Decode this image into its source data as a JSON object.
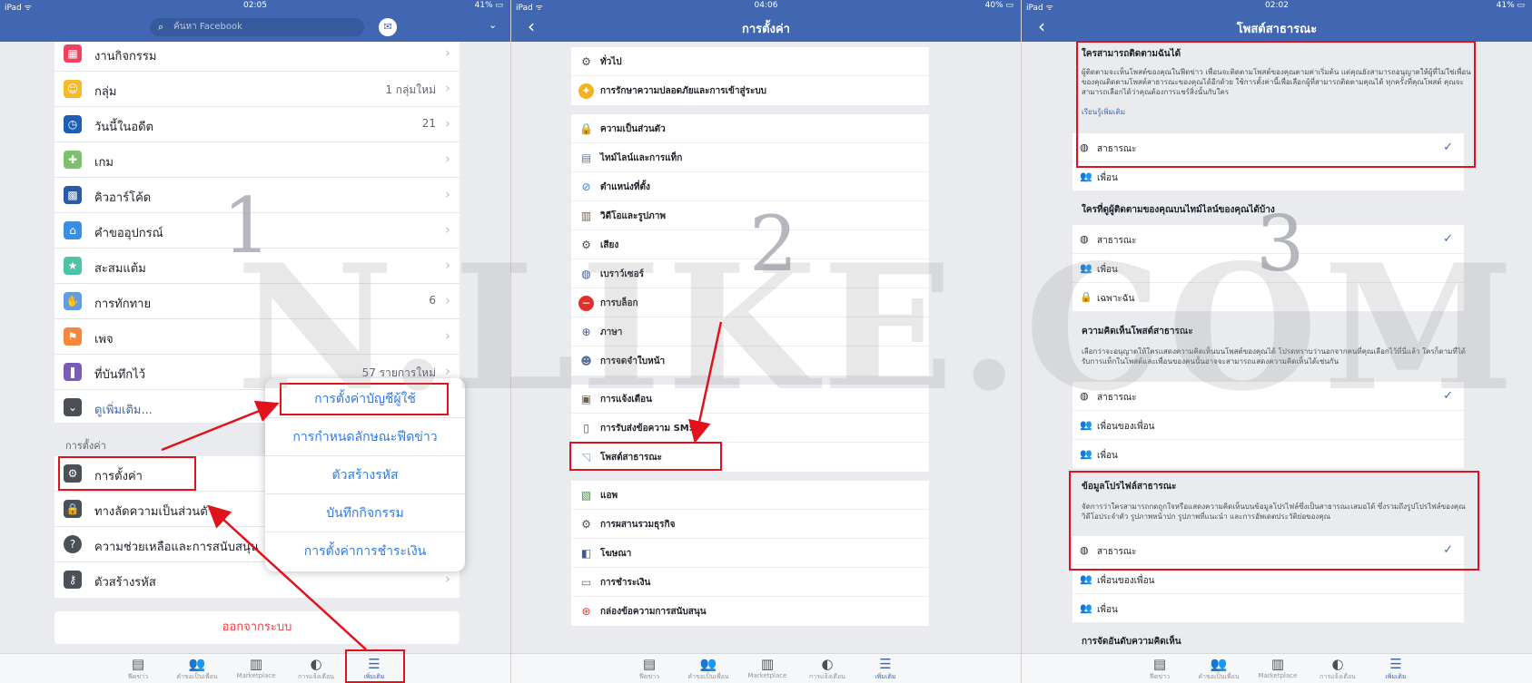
{
  "panel1": {
    "status": {
      "left": "iPad ᯤ",
      "time": "02:05",
      "right": "41% ▭"
    },
    "search_placeholder": "ค้นหา Facebook",
    "menu_items": [
      {
        "label": "งานกิจกรรม",
        "count": ""
      },
      {
        "label": "กลุ่ม",
        "count": "1 กลุ่มใหม่"
      },
      {
        "label": "วันนี้ในอดีต",
        "count": "21"
      },
      {
        "label": "เกม",
        "count": ""
      },
      {
        "label": "คิวอาร์โค้ด",
        "count": ""
      },
      {
        "label": "คำขออุปกรณ์",
        "count": ""
      },
      {
        "label": "สะสมแต้ม",
        "count": ""
      },
      {
        "label": "การทักทาย",
        "count": "6"
      },
      {
        "label": "เพจ",
        "count": ""
      },
      {
        "label": "ที่บันทึกไว้",
        "count": "57 รายการใหม่"
      },
      {
        "label": "ดูเพิ่มเติม...",
        "count": ""
      }
    ],
    "settings_section_label": "การตั้งค่า",
    "settings_items": [
      {
        "label": "การตั้งค่า"
      },
      {
        "label": "ทางลัดความเป็นส่วนตัว"
      },
      {
        "label": "ความช่วยเหลือและการสนับสนุน"
      },
      {
        "label": "ตัวสร้างรหัส"
      }
    ],
    "popup_items": [
      "การตั้งค่าบัญชีผู้ใช้",
      "การกำหนดลักษณะฟีดข่าว",
      "ตัวสร้างรหัส",
      "บันทึกกิจกรรม",
      "การตั้งค่าการชำระเงิน"
    ],
    "logout_label": "ออกจากระบบ",
    "big_number": "1"
  },
  "panel2": {
    "status": {
      "left": "iPad ᯤ",
      "time": "04:06",
      "right": "40% ▭"
    },
    "title": "การตั้งค่า",
    "groups": [
      [
        "ทั่วไป",
        "การรักษาความปลอดภัยและการเข้าสู่ระบบ"
      ],
      [
        "ความเป็นส่วนตัว",
        "ไทม์ไลน์และการแท็ก",
        "ตำแหน่งที่ตั้ง",
        "วิดีโอและรูปภาพ",
        "เสียง",
        "เบราว์เซอร์",
        "การบล็อก",
        "ภาษา",
        "การจดจำใบหน้า"
      ],
      [
        "การแจ้งเตือน",
        "การรับส่งข้อความ SMS",
        "โพสต์สาธารณะ"
      ],
      [
        "แอพ",
        "การผสานรวมธุรกิจ",
        "โฆษณา",
        "การชำระเงิน",
        "กล่องข้อความการสนับสนุน"
      ]
    ],
    "big_number": "2"
  },
  "panel3": {
    "status": {
      "left": "iPad ᯤ",
      "time": "02:02",
      "right": "41% ▭"
    },
    "title": "โพสต์สาธารณะ",
    "q1": {
      "title": "ใครสามารถติดตามฉันได้",
      "desc": "ผู้ติดตามจะเห็นโพสต์ของคุณในฟีดข่าว เพื่อนจะติดตามโพสต์ของคุณตามค่าเริ่มต้น แต่คุณยังสามารถอนุญาตให้ผู้ที่ไม่ใช่เพื่อนของคุณติดตามโพสต์สาธารณะของคุณได้อีกด้วย ใช้การตั้งค่านี้เพื่อเลือกผู้ที่สามารถติดตามคุณได้ ทุกครั้งที่คุณโพสต์ คุณจะสามารถเลือกได้ว่าคุณต้องการแชร์สิ่งนั้นกับใคร",
      "link": "เรียนรู้เพิ่มเติม",
      "options": [
        "สาธารณะ",
        "เพื่อน"
      ]
    },
    "q2": {
      "title": "ใครที่ดูผู้ติดตามของคุณบนไทม์ไลน์ของคุณได้บ้าง",
      "options": [
        "สาธารณะ",
        "เพื่อน",
        "เฉพาะฉัน"
      ]
    },
    "q3": {
      "title": "ความคิดเห็นโพสต์สาธารณะ",
      "desc": "เลือกว่าจะอนุญาตให้ใครแสดงความคิดเห็นบนโพสต์ของคุณได้ โปรดทราบว่านอกจากคนที่คุณเลือกไว้ที่นี่แล้ว ใครก็ตามที่ได้รับการแท็กในโพสต์และเพื่อนของคนนั้นอาจจะสามารถแสดงความคิดเห็นได้เช่นกัน",
      "options": [
        "สาธารณะ",
        "เพื่อนของเพื่อน",
        "เพื่อน"
      ]
    },
    "q4": {
      "title": "ข้อมูลโปรไฟล์สาธารณะ",
      "desc": "จัดการว่าใครสามารถกดถูกใจหรือแสดงความคิดเห็นบนข้อมูลโปรไฟล์ซึ่งเป็นสาธารณะเสมอได้ ซึ่งรวมถึงรูปโปรไฟล์ของคุณ วิดีโอประจำตัว รูปภาพหน้าปก รูปภาพที่แนะนำ และการอัพเดตประวัติย่อของคุณ",
      "options": [
        "สาธารณะ",
        "เพื่อนของเพื่อน",
        "เพื่อน"
      ]
    },
    "q5": {
      "title": "การจัดอันดับความคิดเห็น"
    },
    "big_number": "3"
  },
  "tabbar": [
    "ฟีดข่าว",
    "คำขอเป็นเพื่อน",
    "Marketplace",
    "การแจ้งเตือน",
    "เพิ่มเติม"
  ],
  "watermark": "N.LIKE.COM",
  "colors": {
    "fb_blue": "#4267b2",
    "link_blue": "#2d7be5",
    "highlight_red": "#e3111b",
    "logout_red": "#fa3e3e"
  }
}
